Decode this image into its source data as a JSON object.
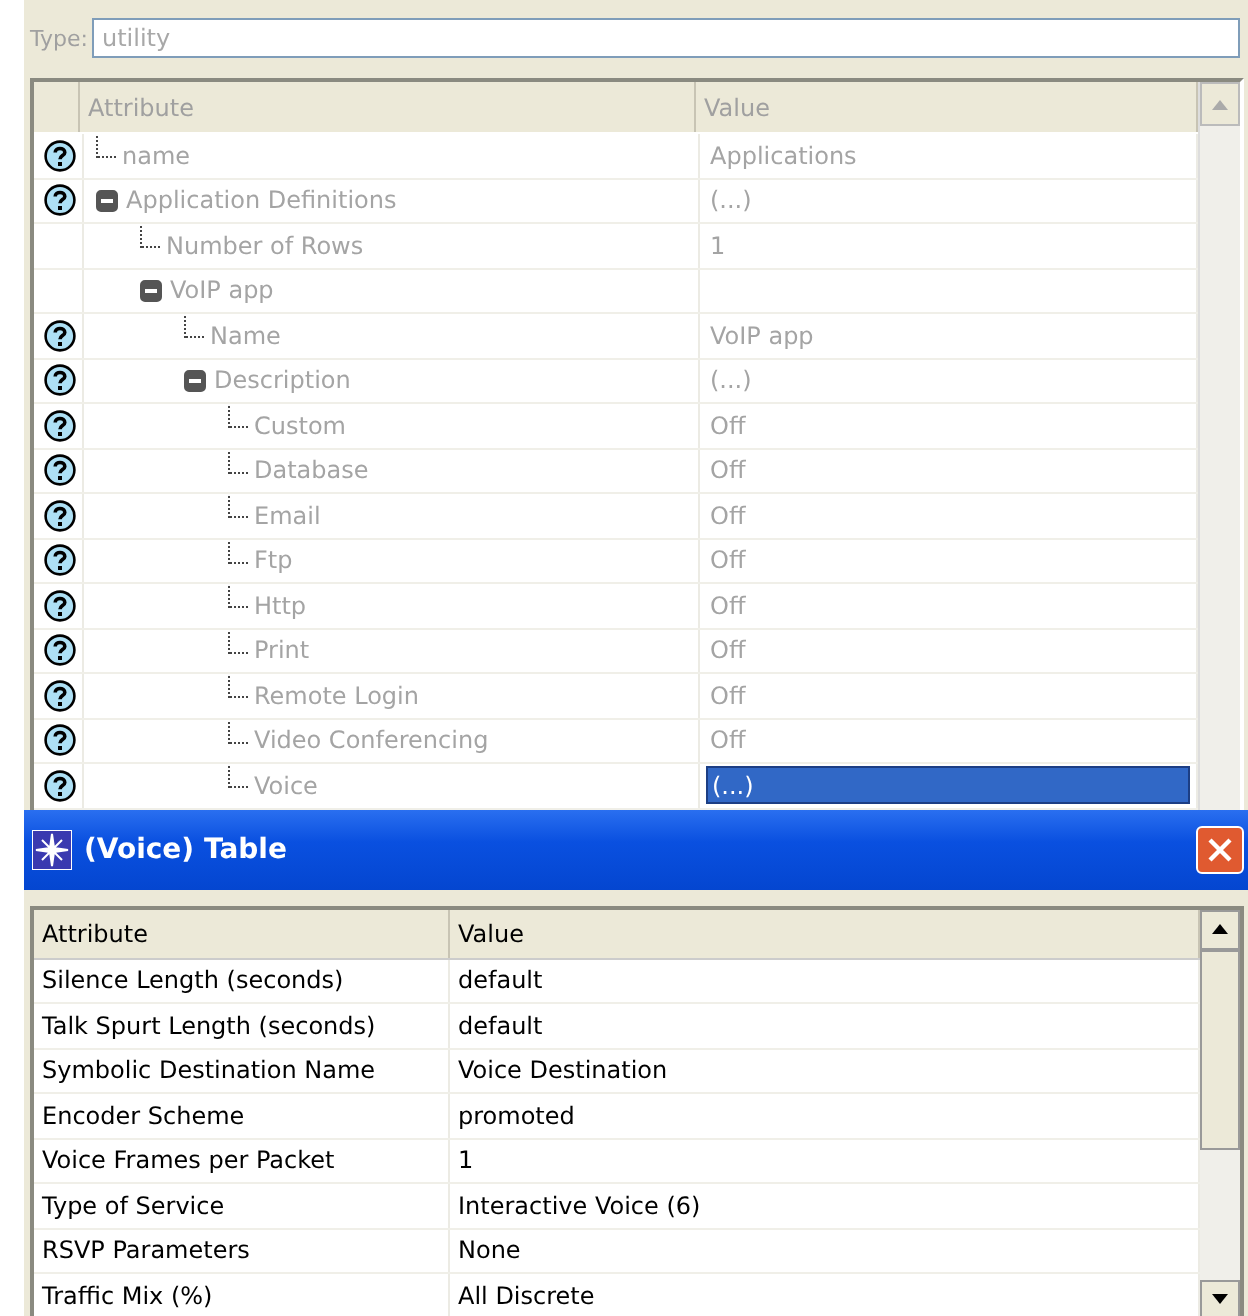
{
  "type_field": {
    "label": "Type:",
    "value": "utility",
    "disabled": true
  },
  "tree": {
    "columns": [
      "Attribute",
      "Value"
    ],
    "rows": [
      {
        "label": "name",
        "value": "Applications",
        "help": true,
        "selected": false
      },
      {
        "label": "Application Definitions",
        "value": "(...)",
        "help": true,
        "selected": false,
        "expanded": true,
        "children": [
          {
            "label": "Number of Rows",
            "value": "1",
            "help": false,
            "selected": false
          },
          {
            "label": "VoIP app",
            "help": false,
            "selected": false,
            "expanded": true,
            "children": [
              {
                "label": "Name",
                "value": "VoIP app",
                "help": true,
                "selected": false
              },
              {
                "label": "Description",
                "value": "(...)",
                "help": true,
                "selected": false,
                "expanded": true,
                "children": [
                  {
                    "label": "Custom",
                    "value": "Off",
                    "help": true,
                    "selected": false
                  },
                  {
                    "label": "Database",
                    "value": "Off",
                    "help": true,
                    "selected": false
                  },
                  {
                    "label": "Email",
                    "value": "Off",
                    "help": true,
                    "selected": false
                  },
                  {
                    "label": "Ftp",
                    "value": "Off",
                    "help": true,
                    "selected": false
                  },
                  {
                    "label": "Http",
                    "value": "Off",
                    "help": true,
                    "selected": false
                  },
                  {
                    "label": "Print",
                    "value": "Off",
                    "help": true,
                    "selected": false
                  },
                  {
                    "label": "Remote Login",
                    "value": "Off",
                    "help": true,
                    "selected": false
                  },
                  {
                    "label": "Video Conferencing",
                    "value": "Off",
                    "help": true,
                    "selected": false
                  },
                  {
                    "label": "Voice",
                    "value": "(...)",
                    "help": true,
                    "selected": true
                  }
                ]
              }
            ]
          }
        ]
      }
    ]
  },
  "dialog": {
    "title": "(Voice) Table",
    "columns": [
      "Attribute",
      "Value"
    ],
    "rows": [
      {
        "attribute": "Silence Length (seconds)",
        "value": "default"
      },
      {
        "attribute": "Talk Spurt Length (seconds)",
        "value": "default"
      },
      {
        "attribute": "Symbolic Destination Name",
        "value": "Voice Destination"
      },
      {
        "attribute": "Encoder Scheme",
        "value": "promoted"
      },
      {
        "attribute": "Voice Frames per Packet",
        "value": "1"
      },
      {
        "attribute": "Type of Service",
        "value": "Interactive Voice (6)"
      },
      {
        "attribute": "RSVP Parameters",
        "value": "None"
      },
      {
        "attribute": "Traffic Mix (%)",
        "value": "All Discrete"
      }
    ]
  }
}
